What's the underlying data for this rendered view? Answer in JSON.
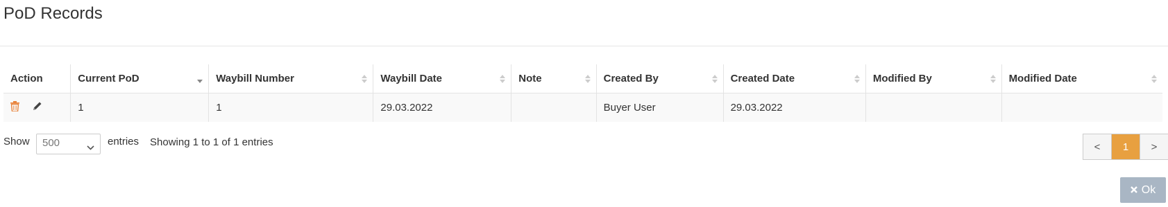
{
  "page": {
    "title": "PoD Records"
  },
  "table": {
    "headers": [
      "Action",
      "Current PoD",
      "Waybill Number",
      "Waybill Date",
      "Note",
      "Created By",
      "Created Date",
      "Modified By",
      "Modified Date"
    ],
    "rows": [
      {
        "current_pod": "1",
        "waybill_number": "1",
        "waybill_date": "29.03.2022",
        "note": "",
        "created_by": "Buyer User",
        "created_date": "29.03.2022",
        "modified_by": "",
        "modified_date": ""
      }
    ],
    "action_icons": [
      "trash-icon",
      "pencil-icon"
    ],
    "sorted_column": "Current PoD",
    "sort_direction": "desc"
  },
  "footer": {
    "show_label": "Show",
    "page_size": "500",
    "entries_label": "entries",
    "info": "Showing 1 to 1 of 1 entries"
  },
  "pagination": {
    "prev": "<",
    "current": "1",
    "next": ">"
  },
  "ok_button": {
    "label": "Ok",
    "icon": "close-icon"
  },
  "colors": {
    "accent": "#e8a040",
    "delete": "#e8833a",
    "ok_button": "#a9b6c4"
  }
}
